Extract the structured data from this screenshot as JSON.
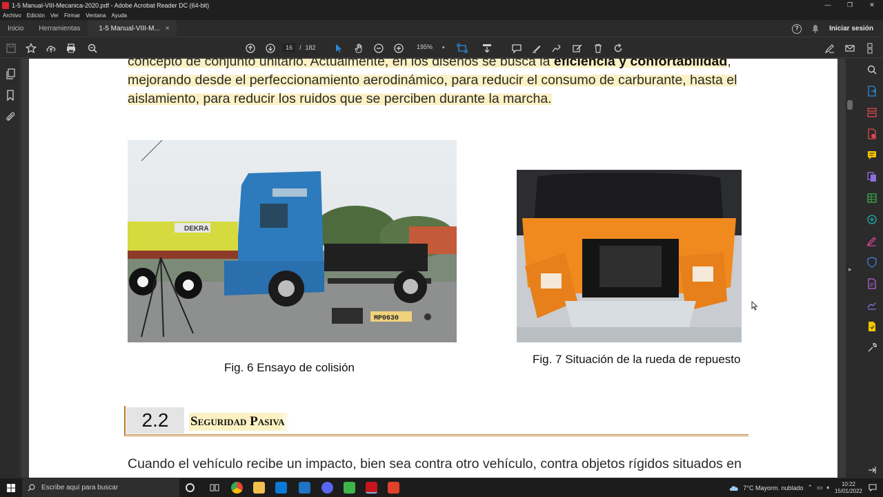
{
  "window": {
    "title": "1-5 Manual-VIII-Mecanica-2020.pdf - Adobe Acrobat Reader DC (64-bit)",
    "controls": [
      "—",
      "❐",
      "✕"
    ]
  },
  "menu": [
    "Archivo",
    "Edición",
    "Ver",
    "Firmar",
    "Ventana",
    "Ayuda"
  ],
  "tabs": {
    "home": "Inicio",
    "tools": "Herramientas",
    "doc": "1-5 Manual-VIII-M...",
    "close": "×",
    "help": "?",
    "signin": "Iniciar sesión"
  },
  "toolbar": {
    "page_current": "16",
    "page_sep": "/",
    "page_total": "182",
    "zoom": "195%"
  },
  "document": {
    "para1_line1_a": "concepto de conjunto unitario. Actualmente, en los diseños se busca la ",
    "para1_line1_b": "eficiencia y confortabilidad",
    "para1_line1_c": ",",
    "para1_line2": "mejorando desde el perfeccionamiento aerodinámico, para reducir el consumo de carburante, hasta el",
    "para1_line3": "aislamiento, para reducir los ruidos que se perciben durante la marcha.",
    "fig6_caption": "Fig. 6 Ensayo de colisión",
    "fig7_caption": "Fig. 7 Situación de la rueda de repuesto",
    "fig6_text_dekra": "DEKRA",
    "fig6_text_plate": "MP0630",
    "section_number": "2.2",
    "section_title": "Seguridad Pasiva",
    "para2_line1": "Cuando el vehículo recibe un impacto, bien sea contra otro vehículo, contra objetos rígidos situados en"
  },
  "taskbar": {
    "search_placeholder": "Escribe aquí para buscar",
    "weather": "7°C  Mayorm. nublado",
    "time": "10:22",
    "date": "15/01/2022"
  },
  "colors": {
    "highlight": "#fbf1c3",
    "section_rule": "#c2853a",
    "accent_blue": "#2d8ad8"
  }
}
